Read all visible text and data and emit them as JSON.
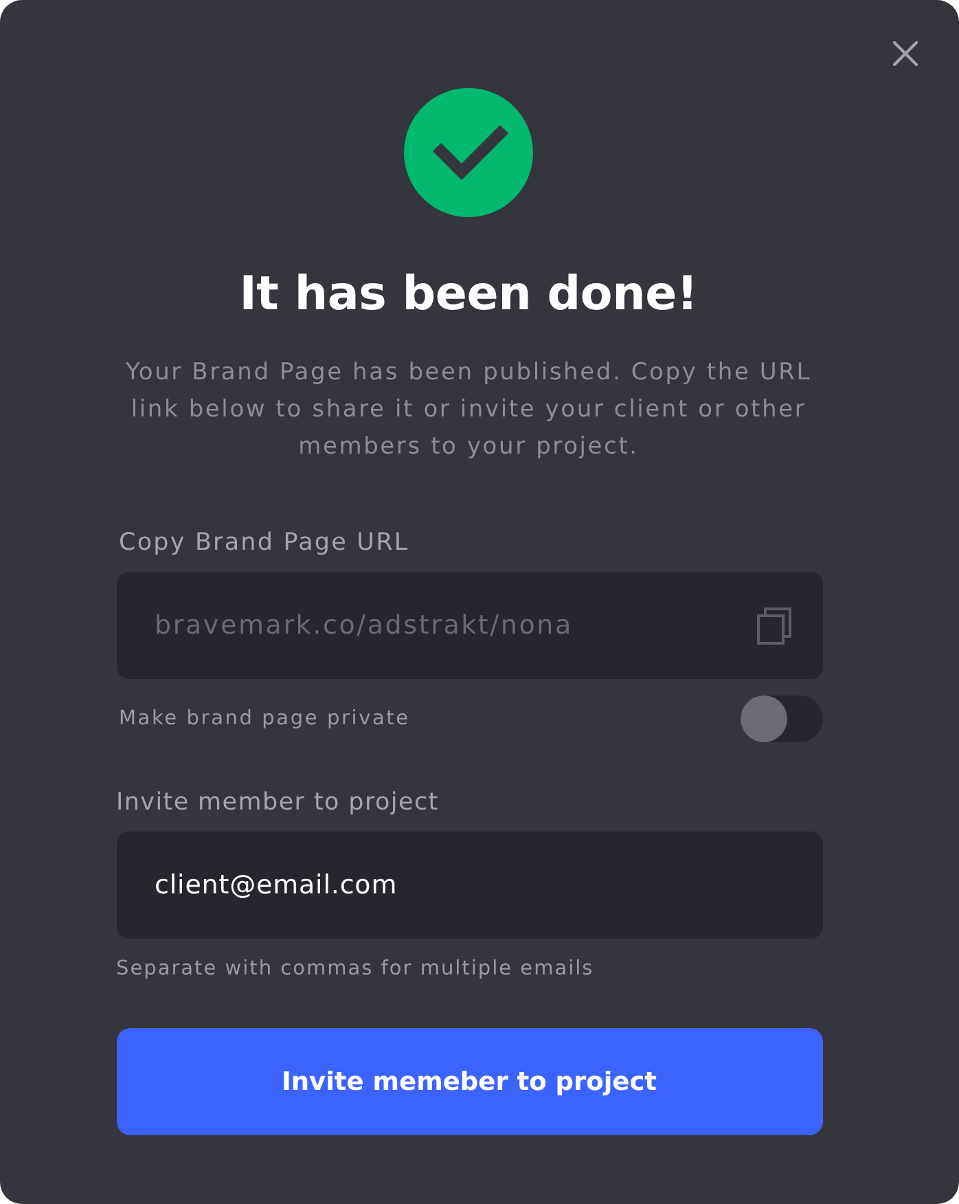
{
  "dialog": {
    "title": "It has been done!",
    "message": "Your Brand Page has been published. Copy the URL link below to share it or invite your client or other members to your project."
  },
  "url_section": {
    "label": "Copy Brand Page URL",
    "field": {
      "value": "bravemark.co/adstrakt/nona",
      "readonly": true
    }
  },
  "privacy_toggle": {
    "label": "Make brand page private",
    "on": false
  },
  "invite_section": {
    "label": "Invite member to project",
    "field": {
      "value": "client@email.com"
    },
    "helper": "Separate with commas for multiple emails"
  },
  "primary_button": {
    "label": "Invite memeber to project"
  }
}
